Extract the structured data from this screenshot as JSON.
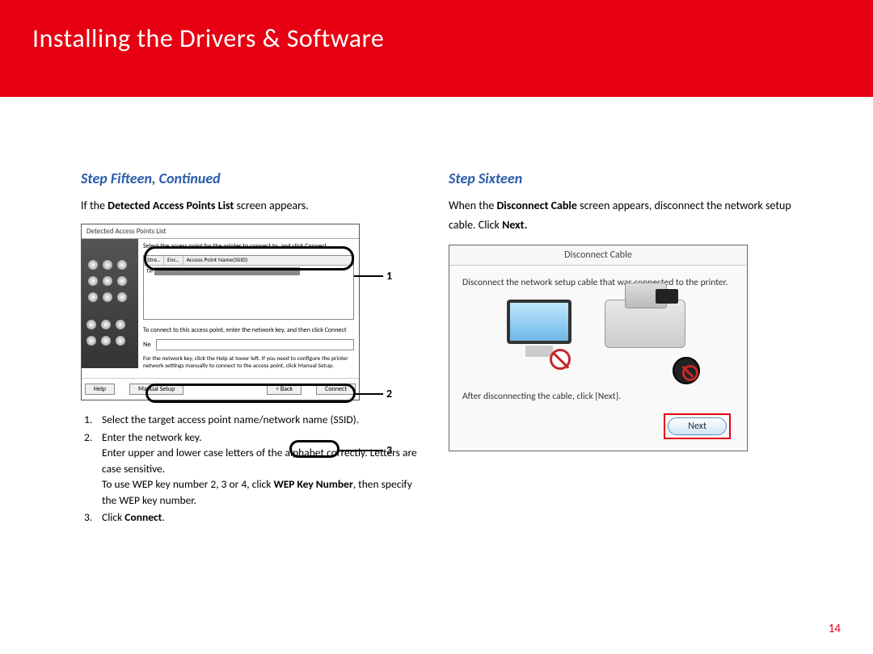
{
  "header": {
    "title": "Installing  the Drivers & Software"
  },
  "page_number": "14",
  "left": {
    "step_title": "Step Fifteen, Continued",
    "intro_pre": "If the ",
    "intro_bold": "Detected Access Points List",
    "intro_post": " screen appears.",
    "dialog": {
      "title": "Detected Access Points List",
      "instruction": "Select the access point for the printer to connect to, and click Connect",
      "col_stre": "Stre..",
      "col_enc": "Enc..",
      "col_ssid": "Access Point Name(SSID)",
      "ap_row_icon": "Tal",
      "connect_instr": "To connect to this access point, enter the network key, and then click Connect",
      "key_label": "Ne",
      "help_text": "For the network key, click the Help at lower left.\nIf you need to configure the printer network settings manually to connect to the access point, click Manual Setup.",
      "btn_help": "Help",
      "btn_manual": "Manual Setup",
      "btn_back": "< Back",
      "btn_connect": "Connect"
    },
    "annotations": {
      "n1": "1",
      "n2": "2",
      "n3": "3"
    },
    "steps": {
      "s1": "Select the target access point name/network name (SSID).",
      "s2a": "Enter the network key.",
      "s2b": "Enter upper and lower case letters of the alphabet correctly. Letters are case sensitive.",
      "s2c_pre": "To use WEP key number 2, 3 or 4, click ",
      "s2c_bold": "WEP Key Number",
      "s2c_post": ", then specify the WEP key number.",
      "s3_pre": "Click ",
      "s3_bold": "Connect",
      "s3_post": "."
    }
  },
  "right": {
    "step_title": "Step Sixteen",
    "intro_pre": "When the ",
    "intro_bold": "Disconnect Cable",
    "intro_mid": " screen appears, disconnect the network setup cable. Click ",
    "intro_bold2": "Next",
    "intro_post": ".",
    "dialog": {
      "title": "Disconnect Cable",
      "text": "Disconnect the network setup cable that was connected to the printer.",
      "after": "After disconnecting the cable, click [Next].",
      "next": "Next"
    }
  }
}
